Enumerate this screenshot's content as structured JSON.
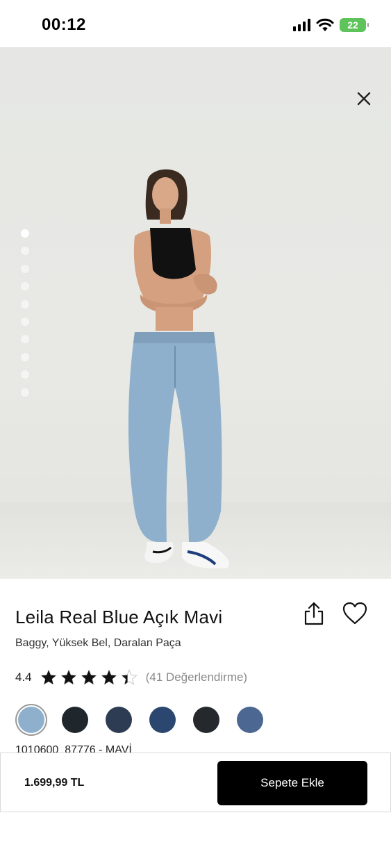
{
  "status_bar": {
    "time": "00:12",
    "battery": "22"
  },
  "gallery": {
    "page_count": 10,
    "current_page": 1,
    "close_icon": "close-icon"
  },
  "product": {
    "title": "Leila Real Blue Açık Mavi",
    "subtitle": "Baggy, Yüksek Bel, Daralan Paça",
    "rating_value": "4.4",
    "rating": 4.4,
    "rating_max": 5,
    "rating_count": "(41 Değerlendirme)",
    "sku_text": "1010600_87776 - MAVİ",
    "swatches": [
      {
        "color": "#8fb0cc",
        "selected": true
      },
      {
        "color": "#1f272c",
        "selected": false
      },
      {
        "color": "#2d3c52",
        "selected": false
      },
      {
        "color": "#2b4770",
        "selected": false
      },
      {
        "color": "#25282c",
        "selected": false
      },
      {
        "color": "#4c6791",
        "selected": false
      }
    ]
  },
  "actions": {
    "share_icon": "share-icon",
    "favorite_icon": "heart-icon"
  },
  "purchase": {
    "price": "1.699,99 TL",
    "add_to_cart_label": "Sepete Ekle"
  },
  "colors": {
    "button_bg": "#000000",
    "star_fill": "#111111",
    "battery_green": "#5ec35b"
  }
}
